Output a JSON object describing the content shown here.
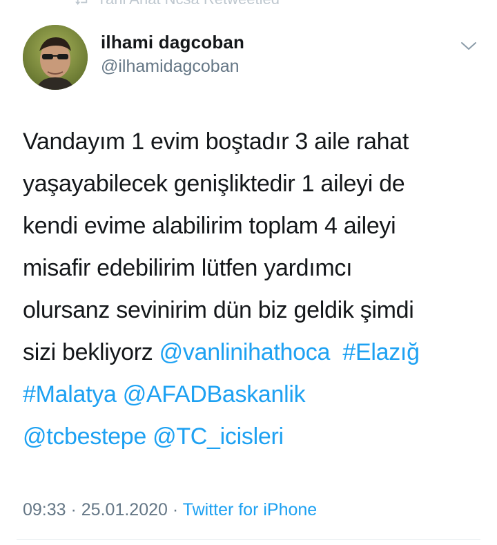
{
  "retweet_header": {
    "icon": "retweet-icon",
    "text": "Yahi Anat Ncsa Retweetled"
  },
  "author": {
    "name": "ilhami dagcoban",
    "handle": "@ilhamidagcoban",
    "avatar_icon": "avatar"
  },
  "menu": {
    "icon": "chevron-down-icon"
  },
  "tweet": {
    "lines": [
      [
        "Vandayım 1 evim boştadır 3 aile rahat"
      ],
      [
        "yaşayabilecek genişliktedir 1 aileyi de"
      ],
      [
        "kendi evime alabilirim toplam 4 aileyi"
      ],
      [
        "misafir edebilirim lütfen yardımcı"
      ],
      [
        "olursanz sevinirim dün biz geldik şimdi"
      ],
      [
        "sizi bekliyorz "
      ],
      [],
      []
    ],
    "plain": {
      "l1": "Vandayım 1 evim boştadır 3 aile rahat",
      "l2": "yaşayabilecek genişliktedir 1 aileyi de",
      "l3": "kendi evime alabilirim toplam 4 aileyi",
      "l4": "misafir edebilirim lütfen yardımcı",
      "l5": "olursanz sevinirim dün biz geldik şimdi",
      "l6": "sizi bekliyorz "
    },
    "links": {
      "mention_vanlinihathoca": "@vanlinihathoca",
      "hashtag_elazig": "#Elazığ",
      "hashtag_malatya": "#Malatya",
      "mention_afad": "@AFADBaskanlik",
      "mention_tcbestepe": "@tcbestepe",
      "mention_tc_icisleri": "@TC_icisleri"
    }
  },
  "meta": {
    "time": "09:33",
    "separator": " · ",
    "date": "25.01.2020",
    "source": "Twitter for iPhone"
  },
  "colors": {
    "link": "#1da1f2",
    "text": "#14171a",
    "secondary": "#657786",
    "divider": "#e1e8ed"
  }
}
